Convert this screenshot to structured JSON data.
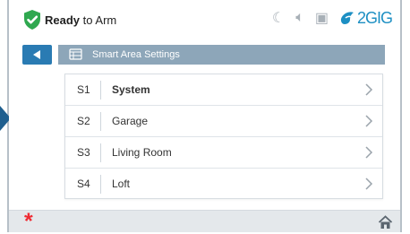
{
  "status": {
    "ready_label": "Ready",
    "arm_label": "to Arm",
    "brand_label": "2GIG",
    "icons": [
      "moon-icon",
      "volume-icon",
      "screen-icon",
      "2gig-logo-icon"
    ]
  },
  "header": {
    "title": "Smart Area Settings",
    "back_icon": "left-arrow-icon",
    "title_icon": "settings-grid-icon"
  },
  "settings": [
    {
      "code": "S1",
      "name": "System"
    },
    {
      "code": "S2",
      "name": "Garage"
    },
    {
      "code": "S3",
      "name": "Living Room"
    },
    {
      "code": "S4",
      "name": "Loft"
    }
  ],
  "footer": {
    "panic_icon": "asterisk-icon",
    "home_icon": "home-icon"
  },
  "colors": {
    "shield": "#2fa84f",
    "back_button": "#2a7bb3",
    "title_bar": "#8da6b9",
    "accent": "#1d8fc3",
    "panic": "#ef2b32",
    "pointer": "#1f5f8f"
  }
}
